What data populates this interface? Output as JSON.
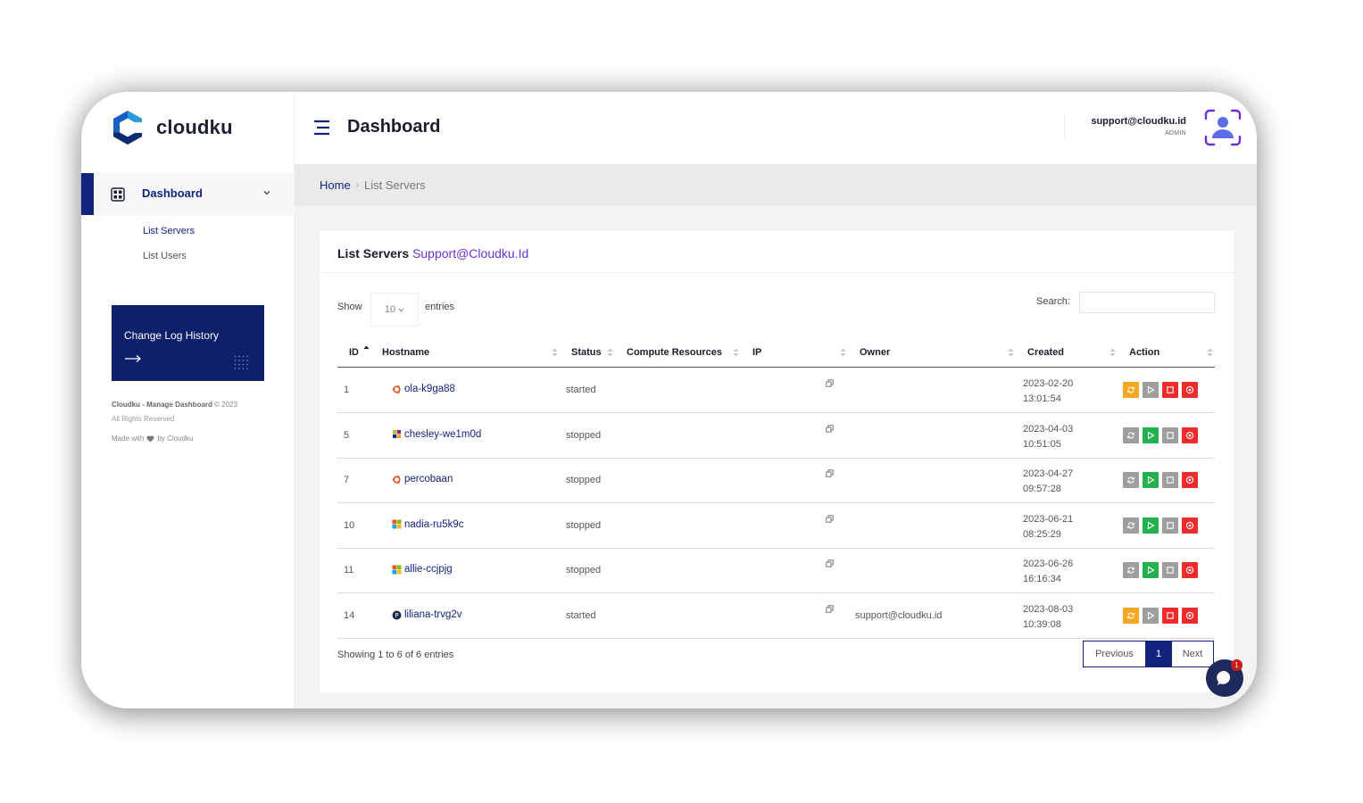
{
  "app": {
    "name": "cloudku"
  },
  "sidebar": {
    "nav_label": "Dashboard",
    "sub_items": [
      "List Servers",
      "List Users"
    ],
    "changelog": "Change Log History",
    "footer_brand": "Cloudku - Manage Dashboard",
    "footer_year": "© 2023",
    "footer_rights": "All Rights Reserved",
    "footer_made_prefix": "Made with",
    "footer_made_suffix": "by Cloudku"
  },
  "header": {
    "title": "Dashboard",
    "email": "support@cloudku.id",
    "role": "ADMIN"
  },
  "breadcrumb": {
    "home": "Home",
    "separator": "›",
    "current": "List Servers"
  },
  "card": {
    "title_prefix": "List Servers",
    "title_accent": "Support@Cloudku.Id",
    "show_label": "Show",
    "page_length": "10",
    "entries_label": "entries",
    "search_label": "Search:",
    "search_value": ""
  },
  "table": {
    "columns": [
      "ID",
      "Hostname",
      "Status",
      "Compute Resources",
      "IP",
      "Owner",
      "Created",
      "Action"
    ],
    "rows": [
      {
        "id": "1",
        "os": "ubuntu",
        "hostname": "ola-k9ga88",
        "status": "started",
        "owner": "",
        "created_date": "2023-02-20",
        "created_time": "13:01:54",
        "state": "running"
      },
      {
        "id": "5",
        "os": "centos",
        "hostname": "chesley-we1m0d",
        "status": "stopped",
        "owner": "",
        "created_date": "2023-04-03",
        "created_time": "10:51:05",
        "state": "stopped"
      },
      {
        "id": "7",
        "os": "ubuntu",
        "hostname": "percobaan",
        "status": "stopped",
        "owner": "",
        "created_date": "2023-04-27",
        "created_time": "09:57:28",
        "state": "stopped"
      },
      {
        "id": "10",
        "os": "windows",
        "hostname": "nadia-ru5k9c",
        "status": "stopped",
        "owner": "",
        "created_date": "2023-06-21",
        "created_time": "08:25:29",
        "state": "stopped"
      },
      {
        "id": "11",
        "os": "windows",
        "hostname": "allie-ccjpjg",
        "status": "stopped",
        "owner": "",
        "created_date": "2023-06-26",
        "created_time": "16:16:34",
        "state": "stopped"
      },
      {
        "id": "14",
        "os": "pve",
        "hostname": "liliana-trvg2v",
        "status": "started",
        "owner": "support@cloudku.id",
        "created_date": "2023-08-03",
        "created_time": "10:39:08",
        "state": "running"
      }
    ]
  },
  "footer": {
    "info": "Showing 1 to 6 of 6 entries",
    "previous": "Previous",
    "page": "1",
    "next": "Next"
  },
  "chat": {
    "badge": "1"
  },
  "colors": {
    "primary": "#13237d",
    "accent": "#6a2fd1",
    "restart": "#f5a623",
    "start": "#22b14c",
    "stop": "#f02b2b",
    "disabled": "#9e9e9e"
  }
}
